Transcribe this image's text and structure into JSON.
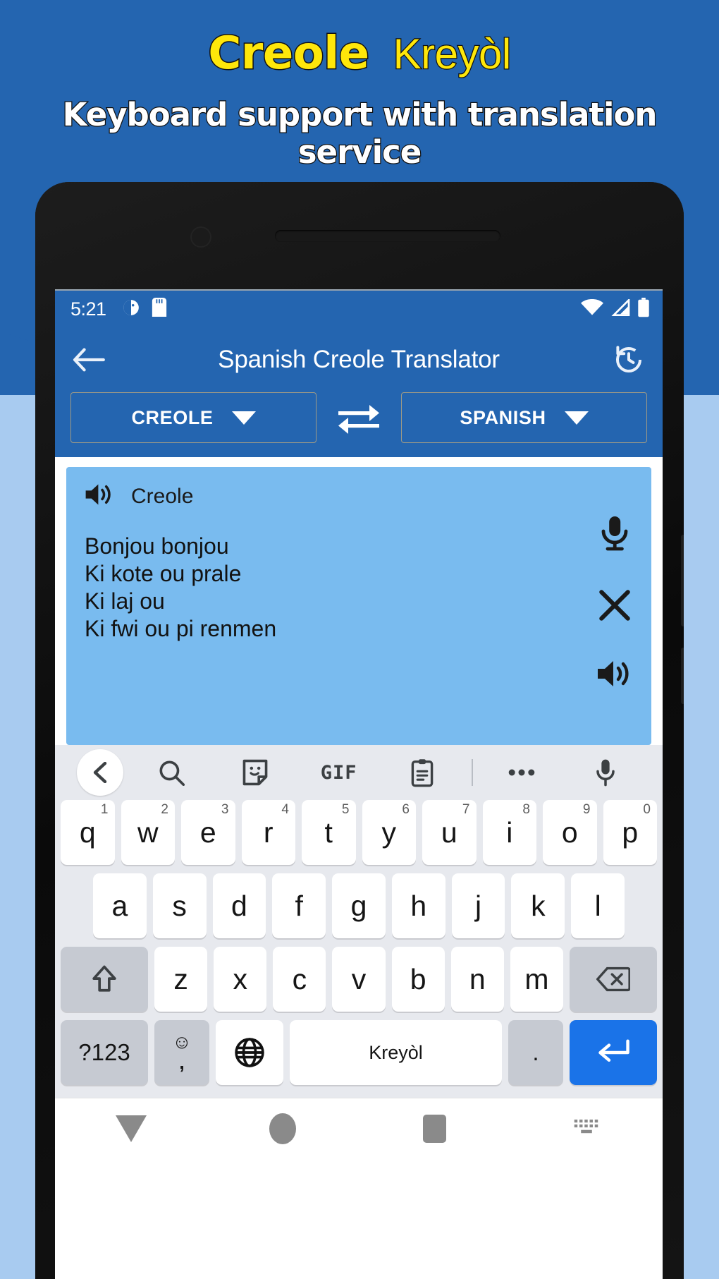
{
  "promo": {
    "title_en": "Creole",
    "title_native": "Kreyòl",
    "subtitle": "Keyboard support with translation service",
    "title_color": "#ffe70a",
    "bg_color": "#2465b0",
    "subtitle_color": "#ffffff"
  },
  "status_bar": {
    "time": "5:21",
    "left_icons": [
      "do-not-disturb-icon",
      "sd-card-icon"
    ],
    "right_icons": [
      "wifi-icon",
      "cell-signal-icon",
      "battery-icon"
    ]
  },
  "app_bar": {
    "back_icon": "arrow-left-icon",
    "title": "Spanish Creole Translator",
    "history_icon": "history-icon",
    "accent_color": "#2465b0"
  },
  "language_bar": {
    "source_language": "CREOLE",
    "target_language": "SPANISH",
    "swap_icon": "swap-horizontal-icon",
    "dropdown_icon": "chevron-down-icon"
  },
  "text_card": {
    "speaker_icon": "volume-up-icon",
    "label": "Creole",
    "content": "Bonjou bonjou\nKi kote ou prale\nKi laj ou\nKi fwi ou pi renmen",
    "bg_color": "#79bbef",
    "actions": [
      {
        "name": "mic-icon"
      },
      {
        "name": "close-icon"
      },
      {
        "name": "volume-up-icon"
      }
    ]
  },
  "keyboard": {
    "toolbar": [
      {
        "name": "chevron-left-icon"
      },
      {
        "name": "search-icon"
      },
      {
        "name": "sticker-icon"
      },
      {
        "name": "gif-icon",
        "label": "GIF"
      },
      {
        "name": "clipboard-icon"
      },
      {
        "name": "more-options-icon"
      },
      {
        "name": "mic-icon"
      }
    ],
    "row1": [
      {
        "key": "q",
        "sup": "1"
      },
      {
        "key": "w",
        "sup": "2"
      },
      {
        "key": "e",
        "sup": "3"
      },
      {
        "key": "r",
        "sup": "4"
      },
      {
        "key": "t",
        "sup": "5"
      },
      {
        "key": "y",
        "sup": "6"
      },
      {
        "key": "u",
        "sup": "7"
      },
      {
        "key": "i",
        "sup": "8"
      },
      {
        "key": "o",
        "sup": "9"
      },
      {
        "key": "p",
        "sup": "0"
      }
    ],
    "row2": [
      "a",
      "s",
      "d",
      "f",
      "g",
      "h",
      "j",
      "k",
      "l"
    ],
    "row3_letters": [
      "z",
      "x",
      "c",
      "v",
      "b",
      "n",
      "m"
    ],
    "shift_icon": "shift-icon",
    "backspace_icon": "backspace-icon",
    "symbols_label": "?123",
    "emoji_top": "☺",
    "emoji_bottom": ",",
    "globe_icon": "globe-icon",
    "space_label": "Kreyòl",
    "period_label": ".",
    "enter_icon": "enter-icon",
    "enter_color": "#1a73e8"
  },
  "nav_bar": {
    "items": [
      {
        "name": "nav-back-icon"
      },
      {
        "name": "nav-home-icon"
      },
      {
        "name": "nav-recents-icon"
      },
      {
        "name": "nav-keyboard-icon"
      }
    ]
  }
}
